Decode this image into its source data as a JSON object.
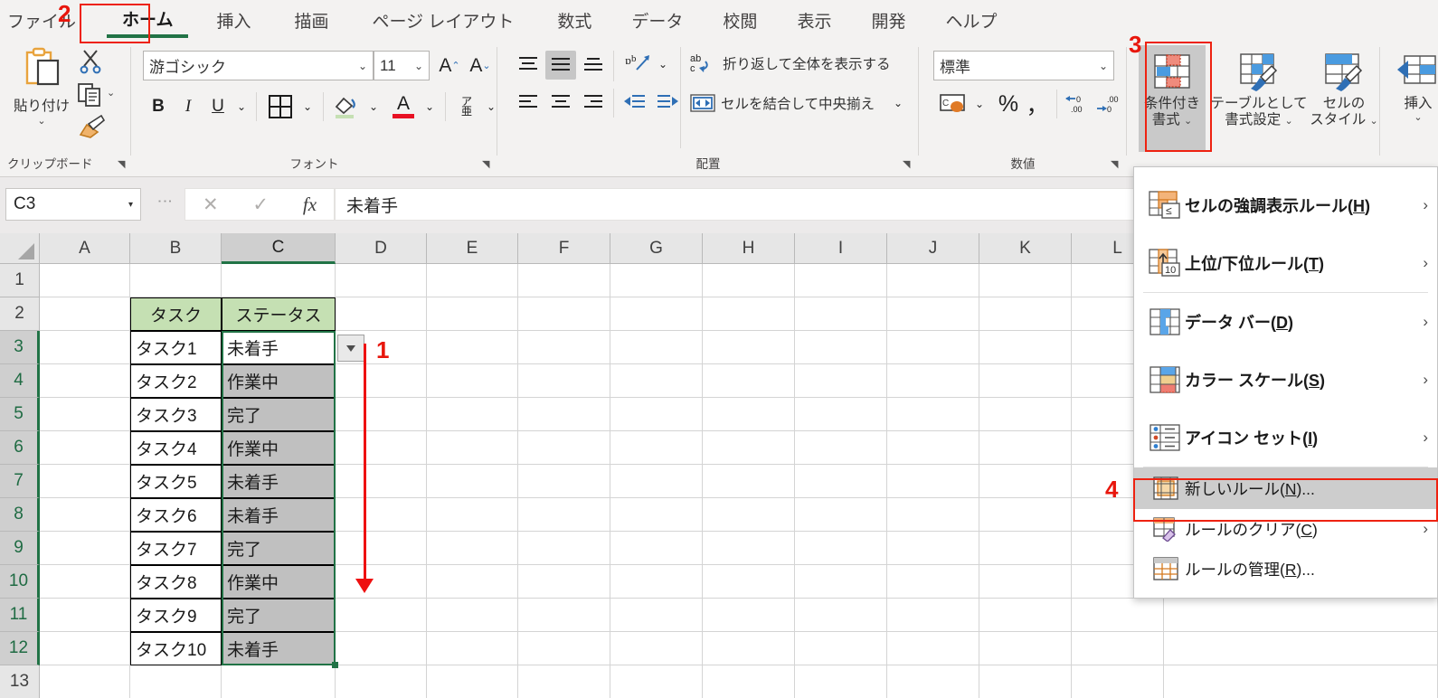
{
  "ribbon": {
    "tabs": [
      {
        "label": "ファイル",
        "active": false
      },
      {
        "label": "ホーム",
        "active": true
      },
      {
        "label": "挿入",
        "active": false
      },
      {
        "label": "描画",
        "active": false
      },
      {
        "label": "ページ レイアウト",
        "active": false
      },
      {
        "label": "数式",
        "active": false
      },
      {
        "label": "データ",
        "active": false
      },
      {
        "label": "校閲",
        "active": false
      },
      {
        "label": "表示",
        "active": false
      },
      {
        "label": "開発",
        "active": false
      },
      {
        "label": "ヘルプ",
        "active": false
      }
    ],
    "groups": {
      "clipboard": {
        "label": "クリップボード",
        "paste_label": "貼り付け"
      },
      "font": {
        "label": "フォント",
        "font_name": "游ゴシック",
        "font_size": "11",
        "bold": "B",
        "italic": "I",
        "underline": "U",
        "grow_font": "A",
        "shrink_font": "A",
        "phonetic": "ア亜"
      },
      "alignment": {
        "label": "配置",
        "wrap_text": "折り返して全体を表示する",
        "merge_center": "セルを結合して中央揃え",
        "orientation_icon": "text-orientation-icon"
      },
      "number": {
        "label": "数値",
        "format": "標準",
        "percent": "%",
        "comma": "，",
        "increase_decimal": ".00",
        "decrease_decimal": ".00"
      },
      "styles": {
        "conditional_formatting": "条件付き\n書式",
        "conditional_formatting_l1": "条件付き",
        "conditional_formatting_l2": "書式",
        "format_as_table_l1": "テーブルとして",
        "format_as_table_l2": "書式設定",
        "cell_styles_l1": "セルの",
        "cell_styles_l2": "スタイル"
      },
      "cells": {
        "insert_l1": "挿入"
      }
    }
  },
  "formula_bar": {
    "name_box": "C3",
    "cancel_icon": "✕",
    "enter_icon": "✓",
    "fx_icon": "fx",
    "formula_value": "未着手"
  },
  "sheet": {
    "columns": [
      "A",
      "B",
      "C",
      "D",
      "E",
      "F",
      "G",
      "H",
      "I",
      "J",
      "K",
      "L"
    ],
    "selected_column": "C",
    "rows": [
      "1",
      "2",
      "3",
      "4",
      "5",
      "6",
      "7",
      "8",
      "9",
      "10",
      "11",
      "12",
      "13"
    ],
    "selected_rows": [
      "3",
      "4",
      "5",
      "6",
      "7",
      "8",
      "9",
      "10",
      "11",
      "12"
    ],
    "table_headers": {
      "b": "タスク",
      "c": "ステータス"
    },
    "table_rows": [
      {
        "row": "3",
        "task": "タスク1",
        "status": "未着手"
      },
      {
        "row": "4",
        "task": "タスク2",
        "status": "作業中"
      },
      {
        "row": "5",
        "task": "タスク3",
        "status": "完了"
      },
      {
        "row": "6",
        "task": "タスク4",
        "status": "作業中"
      },
      {
        "row": "7",
        "task": "タスク5",
        "status": "未着手"
      },
      {
        "row": "8",
        "task": "タスク6",
        "status": "未着手"
      },
      {
        "row": "9",
        "task": "タスク7",
        "status": "完了"
      },
      {
        "row": "10",
        "task": "タスク8",
        "status": "作業中"
      },
      {
        "row": "11",
        "task": "タスク9",
        "status": "完了"
      },
      {
        "row": "12",
        "task": "タスク10",
        "status": "未着手"
      }
    ]
  },
  "menu": {
    "items": [
      {
        "label_pre": "セルの強調表示ルール(",
        "accel": "H",
        "label_post": ")",
        "chevron": "›",
        "icon": "highlight-cells-rules-icon",
        "submenu": true,
        "highlight": false
      },
      {
        "label_pre": "上位/下位ルール(",
        "accel": "T",
        "label_post": ")",
        "chevron": "›",
        "icon": "top-bottom-rules-icon",
        "submenu": true,
        "highlight": false
      },
      {
        "label_pre": "データ バー(",
        "accel": "D",
        "label_post": ")",
        "chevron": "›",
        "icon": "data-bars-icon",
        "submenu": true,
        "highlight": false
      },
      {
        "label_pre": "カラー スケール(",
        "accel": "S",
        "label_post": ")",
        "chevron": "›",
        "icon": "color-scales-icon",
        "submenu": true,
        "highlight": false
      },
      {
        "label_pre": "アイコン セット(",
        "accel": "I",
        "label_post": ")",
        "chevron": "›",
        "icon": "icon-sets-icon",
        "submenu": true,
        "highlight": false
      },
      {
        "label_pre": "新しいルール(",
        "accel": "N",
        "label_post": ")...",
        "chevron": "",
        "icon": "new-rule-icon",
        "submenu": false,
        "highlight": true
      },
      {
        "label_pre": "ルールのクリア(",
        "accel": "C",
        "label_post": ")",
        "chevron": "›",
        "icon": "clear-rules-icon",
        "submenu": true,
        "highlight": false
      },
      {
        "label_pre": "ルールの管理(",
        "accel": "R",
        "label_post": ")...",
        "chevron": "",
        "icon": "manage-rules-icon",
        "submenu": false,
        "highlight": false
      }
    ]
  },
  "annotations": [
    {
      "num": "1",
      "kind": "arrow-down"
    },
    {
      "num": "2",
      "kind": "box-home-tab"
    },
    {
      "num": "3",
      "kind": "box-conditional-formatting"
    },
    {
      "num": "4",
      "kind": "box-new-rule"
    }
  ],
  "colors": {
    "accent_green": "#217346",
    "annotation_red": "#ee1111",
    "header_fill": "#c5e0b3",
    "selection_fill": "#c0c0c0",
    "ribbon_bg": "#f3f2f1"
  }
}
